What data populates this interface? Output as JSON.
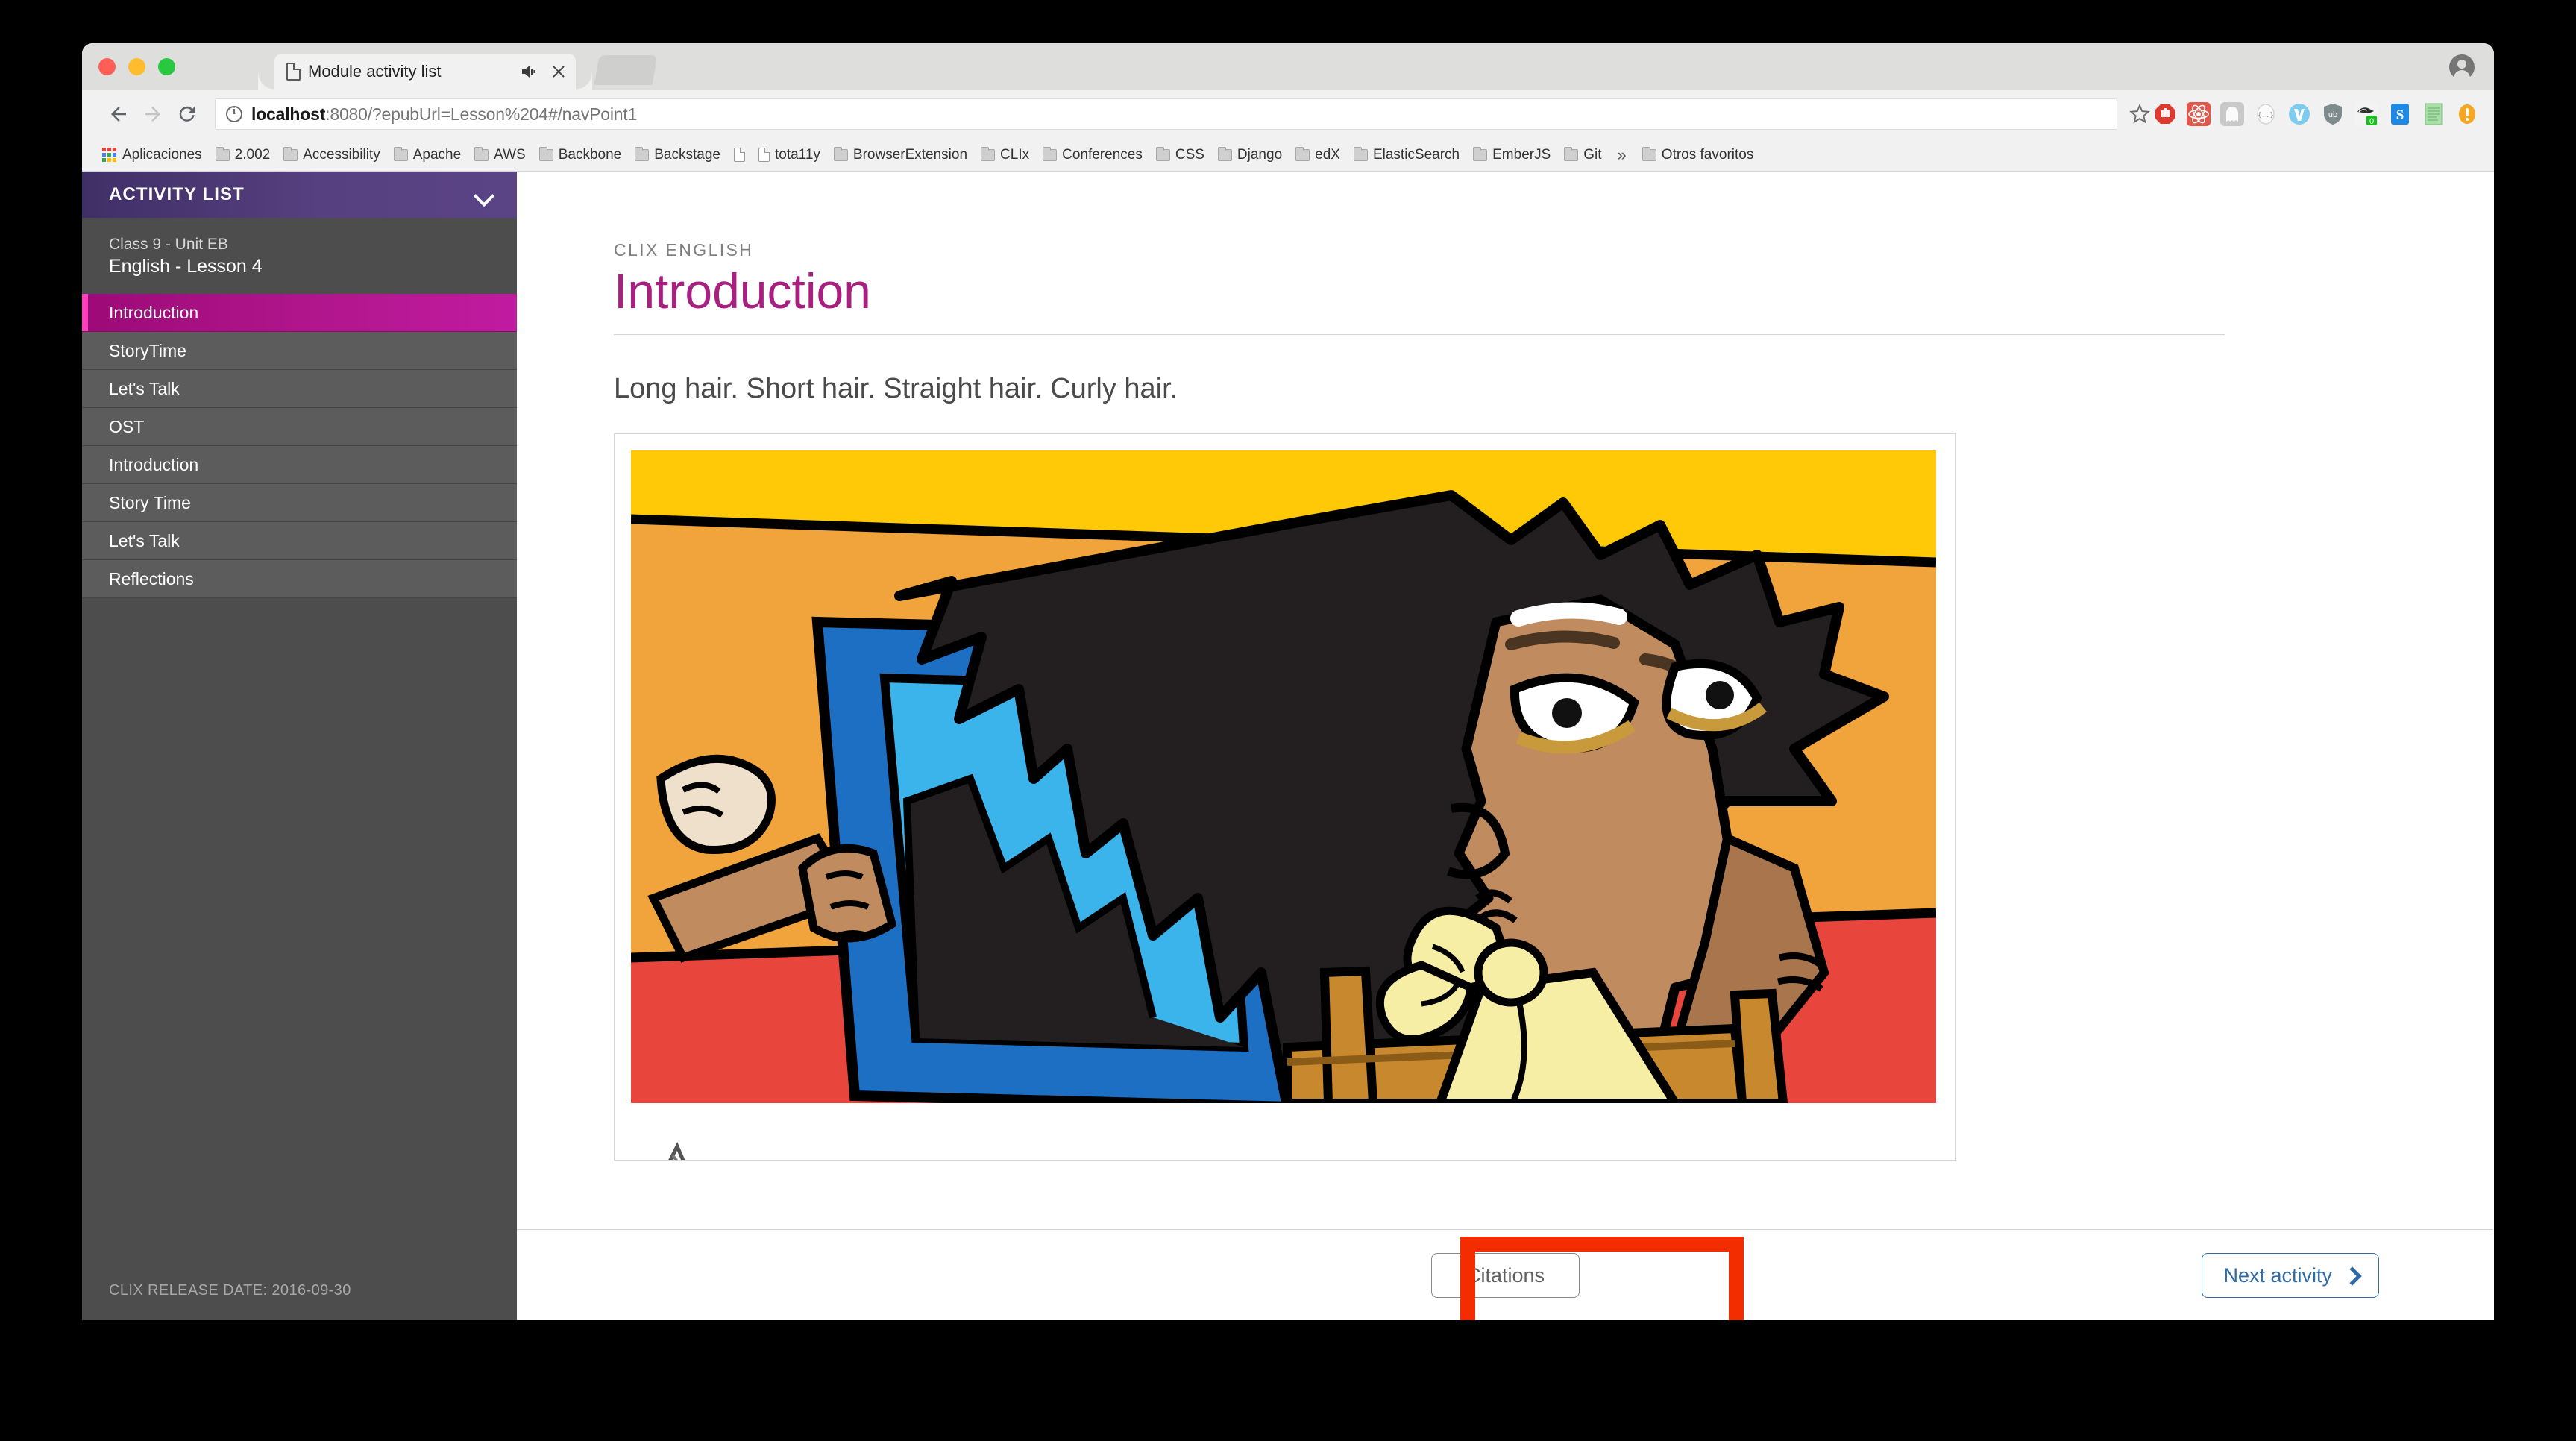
{
  "browser": {
    "tab": {
      "title": "Module activity list",
      "favicon": "page-icon",
      "audio_icon": "speaker-icon",
      "close_icon": "close-icon"
    },
    "toolbar": {
      "back_icon": "back-arrow-icon",
      "forward_icon": "forward-arrow-icon",
      "reload_icon": "reload-icon",
      "info_icon": "info-circle-icon",
      "url_host": "localhost",
      "url_rest": ":8080/?epubUrl=Lesson%204#/navPoint1",
      "url_full": "localhost:8080/?epubUrl=Lesson%204#/navPoint1",
      "star_icon": "star-icon",
      "profile_icon": "profile-avatar-icon",
      "extensions": [
        {
          "name": "adblock-icon",
          "color": "#e03a2f"
        },
        {
          "name": "react-devtools-icon",
          "color": "#e2574c"
        },
        {
          "name": "ghost-extension-icon",
          "color": "#b9b9b9"
        },
        {
          "name": "json-formatter-icon",
          "color": "#f4f4f4"
        },
        {
          "name": "vimium-icon",
          "color": "#57b9e8"
        },
        {
          "name": "ublock-origin-icon",
          "color": "#7f8c8d"
        },
        {
          "name": "privacy-badger-icon",
          "color": "#e8e8e8"
        },
        {
          "name": "stylish-icon",
          "color": "#1e88e5"
        },
        {
          "name": "notepad-extension-icon",
          "color": "#8fd88f"
        },
        {
          "name": "warning-extension-icon",
          "color": "#f5a623"
        }
      ]
    },
    "bookmarks": {
      "apps_label": "Aplicaciones",
      "items": [
        {
          "label": "2.002",
          "icon": "folder-icon"
        },
        {
          "label": "Accessibility",
          "icon": "folder-icon"
        },
        {
          "label": "Apache",
          "icon": "folder-icon"
        },
        {
          "label": "AWS",
          "icon": "folder-icon"
        },
        {
          "label": "Backbone",
          "icon": "folder-icon"
        },
        {
          "label": "Backstage",
          "icon": "folder-icon"
        },
        {
          "label": "",
          "icon": "page-icon"
        },
        {
          "label": "tota11y",
          "icon": "page-icon"
        },
        {
          "label": "BrowserExtension",
          "icon": "folder-icon"
        },
        {
          "label": "CLIx",
          "icon": "folder-icon"
        },
        {
          "label": "Conferences",
          "icon": "folder-icon"
        },
        {
          "label": "CSS",
          "icon": "folder-icon"
        },
        {
          "label": "Django",
          "icon": "folder-icon"
        },
        {
          "label": "edX",
          "icon": "folder-icon"
        },
        {
          "label": "ElasticSearch",
          "icon": "folder-icon"
        },
        {
          "label": "EmberJS",
          "icon": "folder-icon"
        },
        {
          "label": "Git",
          "icon": "folder-icon"
        }
      ],
      "overflow_label": "»",
      "other_label": "Otros favoritos"
    }
  },
  "sidebar": {
    "header_title": "ACTIVITY LIST",
    "chevron_icon": "chevron-down-icon",
    "unit": "Class 9 - Unit EB",
    "lesson": "English - Lesson 4",
    "items": [
      {
        "label": "Introduction",
        "selected": true
      },
      {
        "label": "StoryTime",
        "selected": false
      },
      {
        "label": "Let's Talk",
        "selected": false
      },
      {
        "label": "OST",
        "selected": false
      },
      {
        "label": "Introduction",
        "selected": false
      },
      {
        "label": "Story Time",
        "selected": false
      },
      {
        "label": "Let's Talk",
        "selected": false
      },
      {
        "label": "Reflections",
        "selected": false
      }
    ],
    "release_date": "CLIX RELEASE DATE: 2016-09-30",
    "colors": {
      "header_gradient_start": "#3f2f67",
      "header_gradient_end": "#5b4486",
      "selected_gradient_start": "#9c0a77",
      "selected_gradient_end": "#c11ba0",
      "selected_marker": "#ff3fbe",
      "item_bg": "#5c5c5c",
      "panel_bg": "#4d4d4d"
    }
  },
  "main": {
    "eyebrow": "CLIX ENGLISH",
    "title": "Introduction",
    "lead_text": "Long hair. Short hair. Straight hair. Curly hair.",
    "title_color": "#a8207f",
    "illustration": {
      "name": "girl-with-mirror-illustration",
      "alt": "Cartoon girl with long black hair holding a blue-framed mirror while sitting on a wooden chair",
      "colors": {
        "sky": "#ffc907",
        "wall": "#f1a33c",
        "floor": "#e8453c",
        "hair": "#231f20",
        "skin": "#c08b5f",
        "skin_shadow": "#a9754c",
        "mirror_frame": "#1d6fc4",
        "mirror_glass": "#3bb4ec",
        "dress": "#f7eea6",
        "chair": "#c8892e"
      }
    },
    "audio_control_icon": "audio-waveform-icon"
  },
  "action_bar": {
    "citations_label": "Citations",
    "next_activity_label": "Next activity",
    "next_chevron_icon": "chevron-right-icon",
    "next_color": "#2f6aa8"
  },
  "annotation": {
    "name": "citations-highlight-box",
    "color": "#f42d00"
  }
}
